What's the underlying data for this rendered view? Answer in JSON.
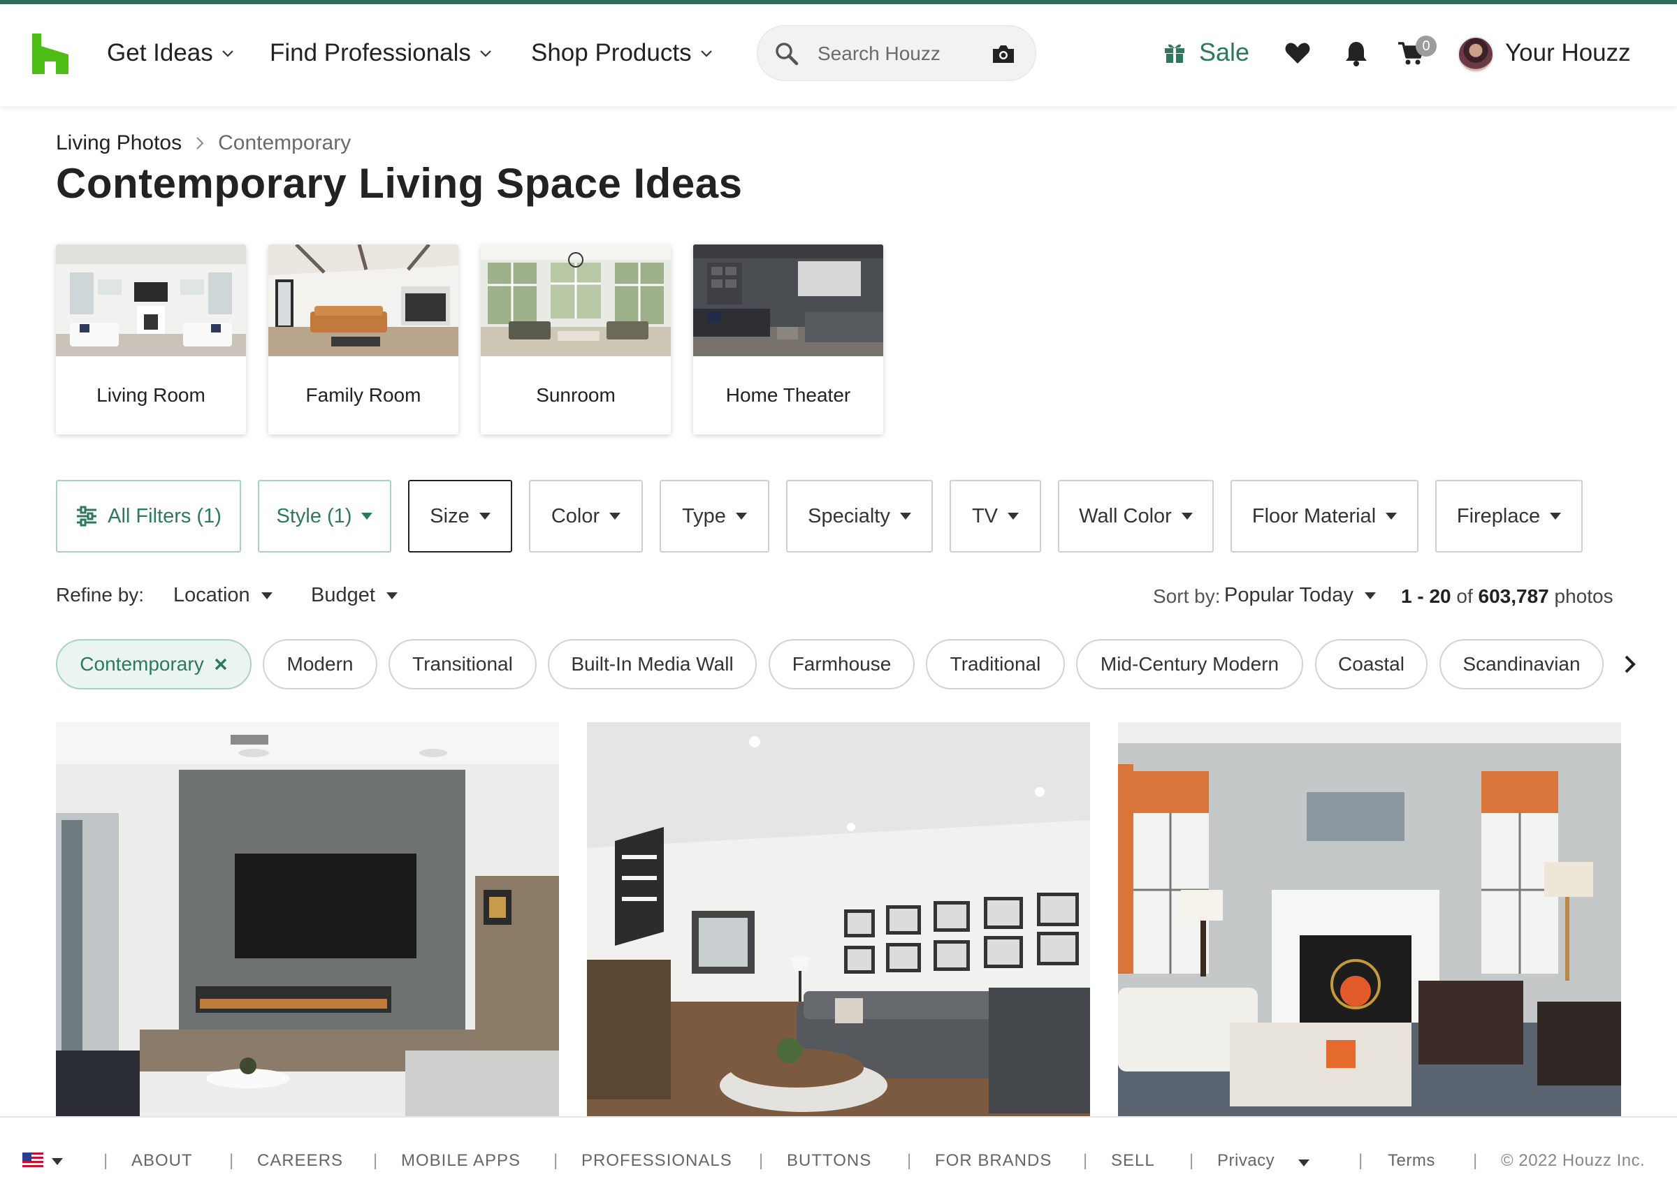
{
  "header": {
    "nav": [
      "Get Ideas",
      "Find Professionals",
      "Shop Products"
    ],
    "search_placeholder": "Search Houzz",
    "sale_label": "Sale",
    "cart_count": "0",
    "account_label": "Your Houzz",
    "brand_color": "#4dbc15",
    "accent_color": "#2c7a5b"
  },
  "breadcrumb": {
    "parent": "Living Photos",
    "current": "Contemporary"
  },
  "page_title": "Contemporary Living Space Ideas",
  "room_types": [
    "Living Room",
    "Family Room",
    "Sunroom",
    "Home Theater"
  ],
  "filters": [
    "All Filters (1)",
    "Style (1)",
    "Size",
    "Color",
    "Type",
    "Specialty",
    "TV",
    "Wall Color",
    "Floor Material",
    "Fireplace"
  ],
  "refine": {
    "label": "Refine by:",
    "location": "Location",
    "budget": "Budget",
    "sort_label": "Sort by:",
    "sort_value": "Popular Today",
    "count_range": "1 - 20",
    "count_of": "of",
    "count_total": "603,787",
    "count_unit": "photos"
  },
  "style_chips": [
    "Contemporary",
    "Modern",
    "Transitional",
    "Built-In Media Wall",
    "Farmhouse",
    "Traditional",
    "Mid-Century Modern",
    "Coastal",
    "Scandinavian"
  ],
  "footer": {
    "links": [
      "ABOUT",
      "CAREERS",
      "MOBILE APPS",
      "PROFESSIONALS",
      "BUTTONS",
      "FOR BRANDS",
      "SELL",
      "Privacy",
      "Terms"
    ],
    "copyright": "© 2022 Houzz Inc."
  }
}
